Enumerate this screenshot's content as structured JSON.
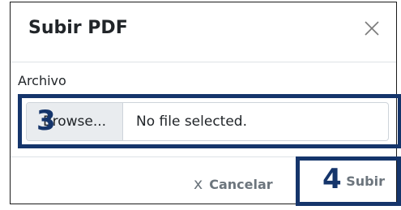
{
  "modal": {
    "title": "Subir PDF",
    "close_icon": "close-icon"
  },
  "form": {
    "file_label": "Archivo",
    "browse_label": "Browse...",
    "file_status": "No file selected."
  },
  "footer": {
    "cancel_icon": "x",
    "cancel_label": "Cancelar",
    "submit_label": "Subir"
  },
  "annotations": {
    "step_3": "3",
    "step_4": "4"
  },
  "colors": {
    "highlight": "#15356b",
    "muted_text": "#6c757d"
  }
}
